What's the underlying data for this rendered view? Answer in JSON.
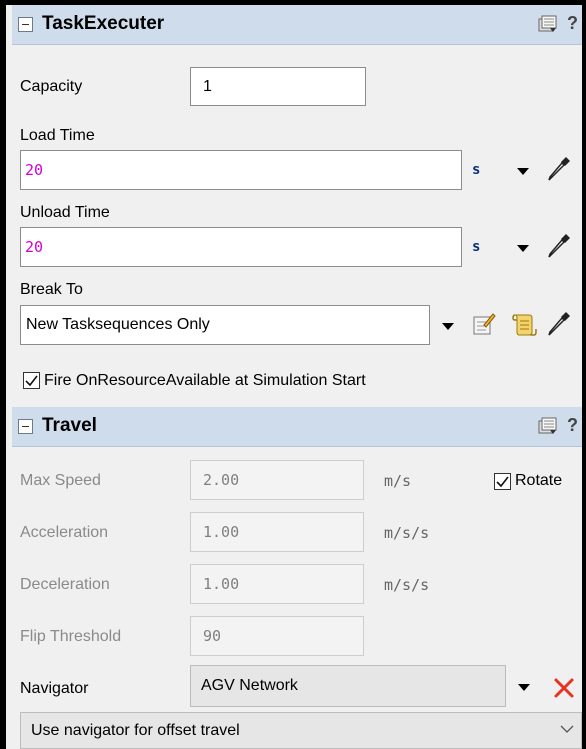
{
  "task_executer": {
    "title": "TaskExecuter",
    "help": "?",
    "capacity": {
      "label": "Capacity",
      "value": "1"
    },
    "load_time": {
      "label": "Load Time",
      "value": "20",
      "unit": "s"
    },
    "unload_time": {
      "label": "Unload Time",
      "value": "20",
      "unit": "s"
    },
    "break_to": {
      "label": "Break To",
      "value": "New Tasksequences Only"
    },
    "fire_on_resource": {
      "label": "Fire OnResourceAvailable at Simulation Start",
      "checked": true
    }
  },
  "travel": {
    "title": "Travel",
    "help": "?",
    "max_speed": {
      "label": "Max Speed",
      "value": "2.00",
      "unit": "m/s"
    },
    "rotate": {
      "label": "Rotate",
      "checked": true
    },
    "acceleration": {
      "label": "Acceleration",
      "value": "1.00",
      "unit": "m/s/s"
    },
    "deceleration": {
      "label": "Deceleration",
      "value": "1.00",
      "unit": "m/s/s"
    },
    "flip_threshold": {
      "label": "Flip Threshold",
      "value": "90"
    },
    "navigator": {
      "label": "Navigator",
      "value": "AGV Network"
    },
    "offset_travel": {
      "value": "Use navigator for offset travel"
    }
  },
  "colors": {
    "header_bg": "#cfdcec",
    "pink_value": "#d400d4",
    "unit_blue": "#0b2e7a",
    "delete_red": "#e8321e"
  },
  "icons": [
    "collapse-icon",
    "properties-icon",
    "help-icon",
    "dropdown-arrow-icon",
    "eyedropper-icon",
    "edit-icon",
    "script-icon",
    "checkbox-icon",
    "delete-icon",
    "chevron-down-icon"
  ]
}
